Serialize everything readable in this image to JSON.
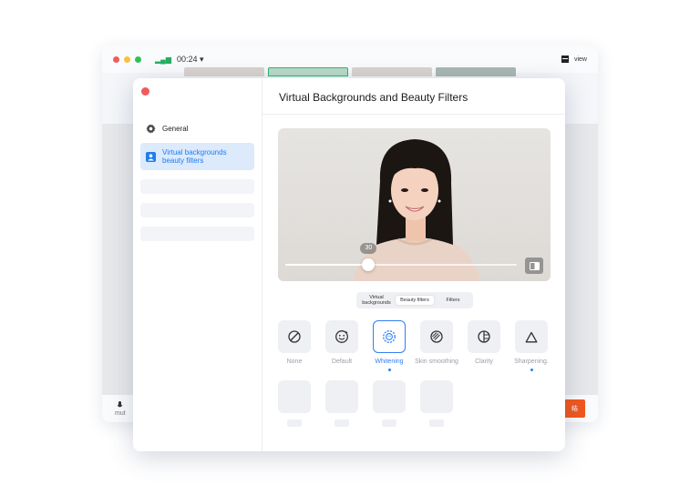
{
  "background_window": {
    "traffic_lights": [
      "#f15b5b",
      "#f7c23a",
      "#2fc25b"
    ],
    "signal_icon": "signal-bars-icon",
    "timer": "00:24",
    "view_label": "view",
    "mute_label": "mut",
    "end_label": "结"
  },
  "dialog": {
    "title": "Virtual Backgrounds and Beauty Filters",
    "close_color": "#f15b5b",
    "sidebar": {
      "items": [
        {
          "label": "General",
          "icon": "gear-icon",
          "selected": false
        },
        {
          "label": "Virtual backgrounds beauty filters",
          "icon": "user-portrait-icon",
          "selected": true
        }
      ]
    },
    "preview": {
      "slider_value": "30",
      "slider_fraction": 0.36,
      "compare_icon": "split-compare-icon"
    },
    "tabs": [
      {
        "label": "Virtual backgrounds",
        "active": false
      },
      {
        "label": "Beauty filters",
        "active": true
      },
      {
        "label": "Filters",
        "active": false
      }
    ],
    "filters": [
      {
        "label": "None",
        "icon": "none-slash-icon",
        "active": false,
        "dot": false
      },
      {
        "label": "Default",
        "icon": "smile-face-icon",
        "active": false,
        "dot": false
      },
      {
        "label": "Whitening",
        "icon": "whitening-face-icon",
        "active": true,
        "dot": true
      },
      {
        "label": "Skin smoothing",
        "icon": "skin-smoothing-icon",
        "active": false,
        "dot": false
      },
      {
        "label": "Clarity",
        "icon": "clarity-icon",
        "active": false,
        "dot": false
      },
      {
        "label": "Sharpening.",
        "icon": "triangle-icon",
        "active": false,
        "dot": true
      }
    ],
    "accent_color": "#2f7ff4"
  }
}
